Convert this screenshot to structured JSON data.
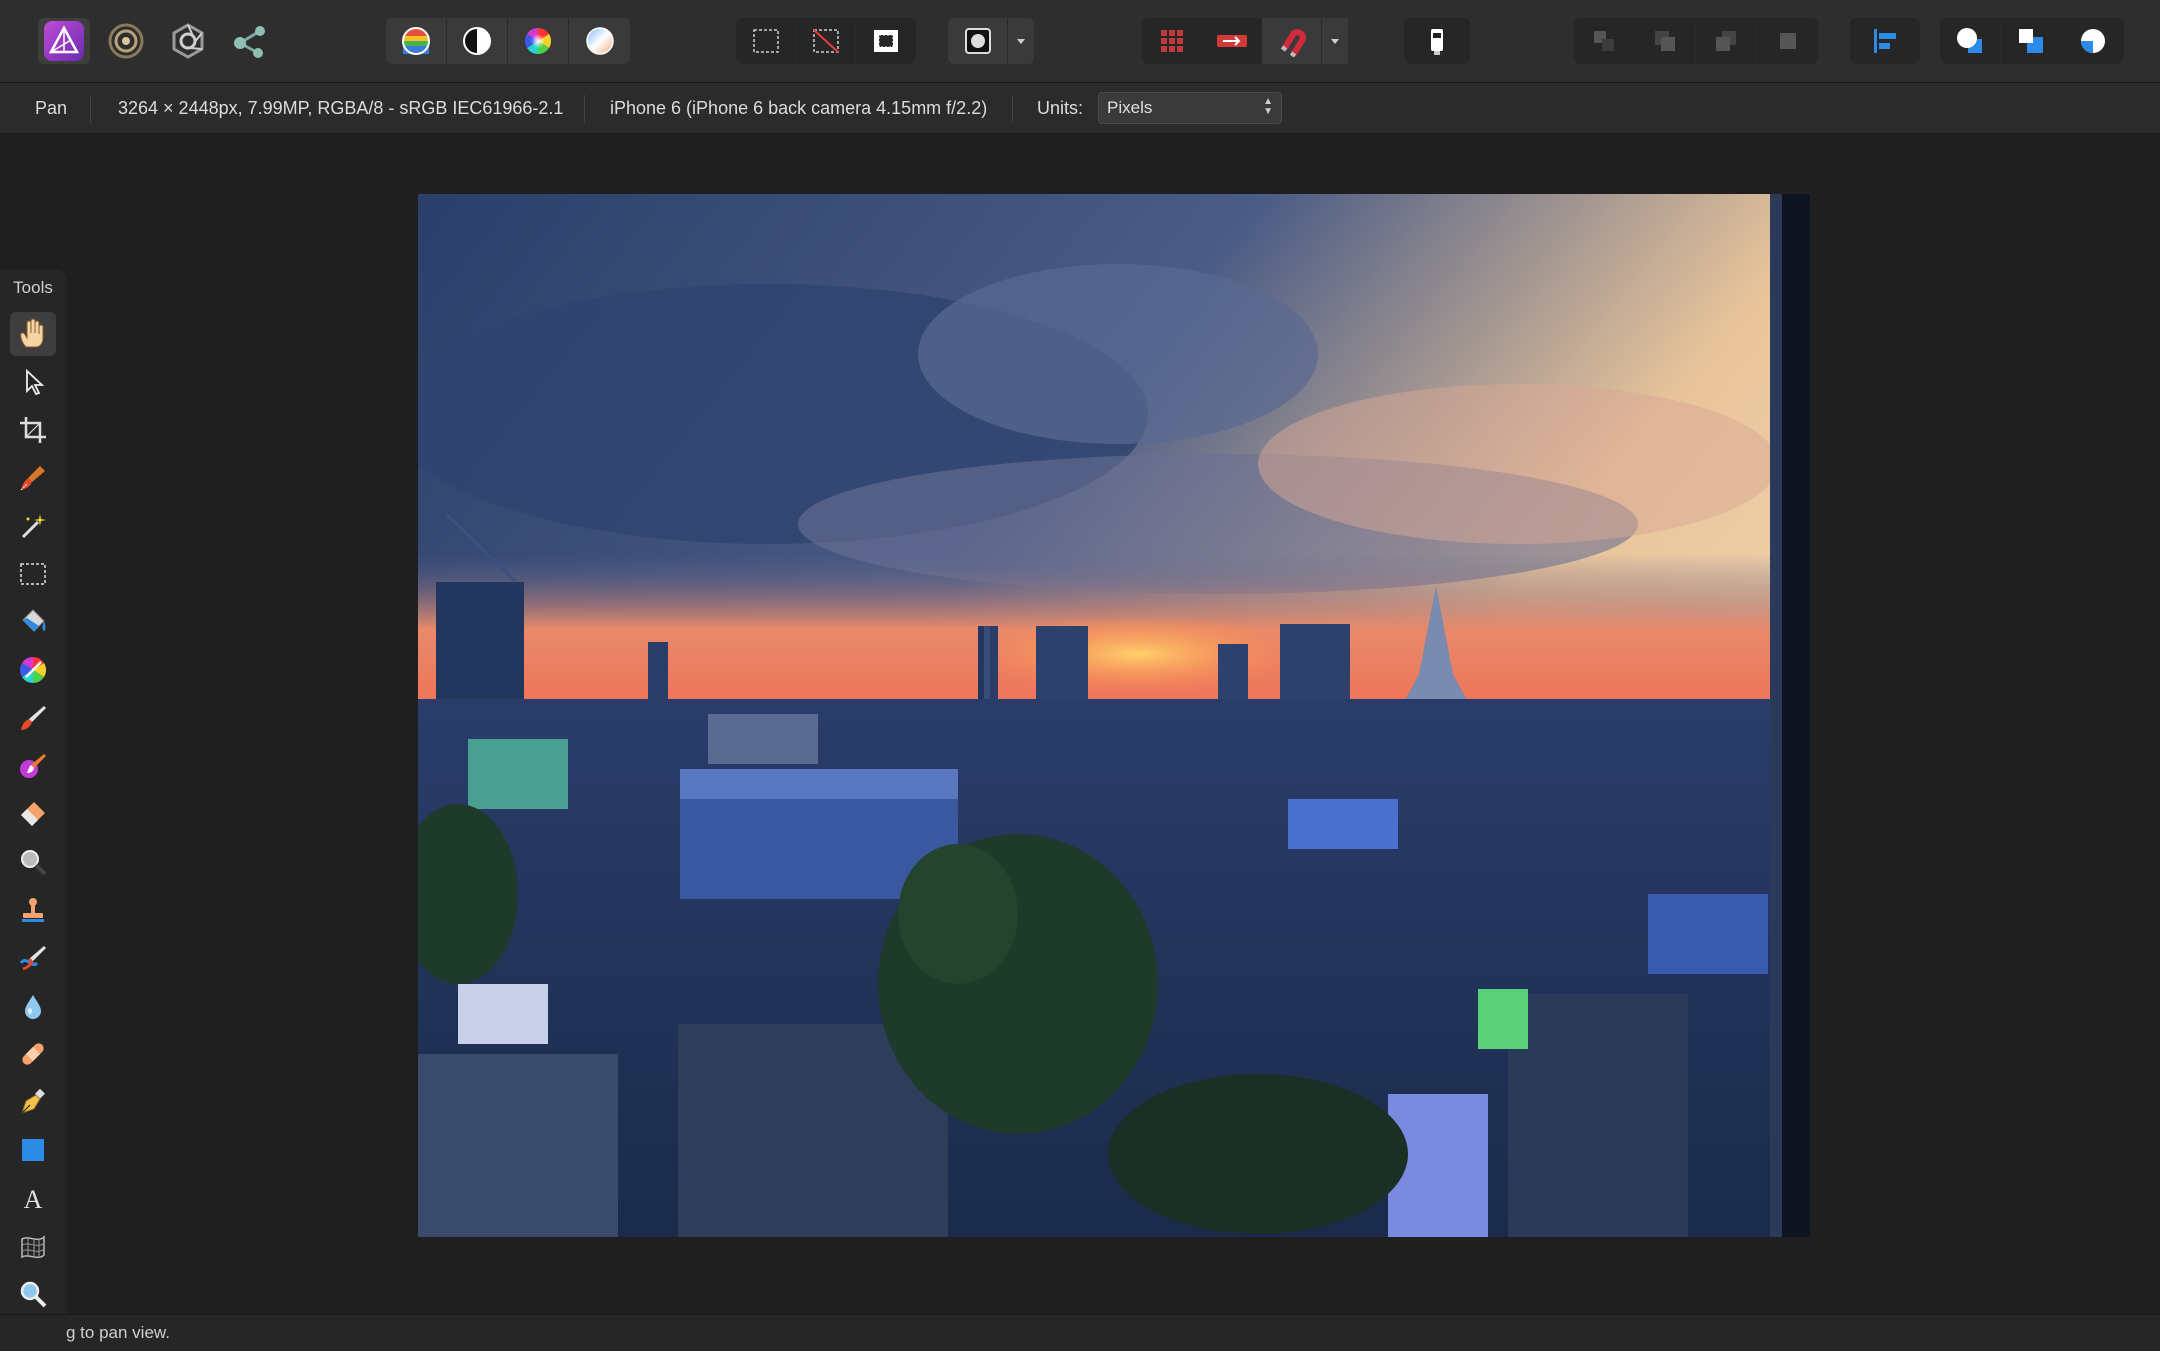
{
  "toolbar": {
    "personas": [
      {
        "name": "photo-persona",
        "icon": "affinity-photo-logo-icon"
      },
      {
        "name": "liquify-persona",
        "icon": "liquify-swirl-icon"
      },
      {
        "name": "develop-persona",
        "icon": "develop-aperture-icon"
      },
      {
        "name": "export-persona",
        "icon": "share-nodes-icon"
      }
    ],
    "color_tools": [
      "auto-levels-icon",
      "auto-contrast-icon",
      "auto-colors-icon",
      "auto-white-balance-icon"
    ],
    "selection_tools": [
      "select-all-icon",
      "deselect-icon",
      "invert-selection-icon"
    ],
    "quick_mask_icon": "quick-mask-icon",
    "snapping_tools": [
      "grid-icon",
      "assistant-icon",
      "snapping-magnet-icon"
    ],
    "brush_icon": "brush-preview-icon",
    "arrange_tools": [
      "move-to-back-icon",
      "move-back-icon",
      "move-forward-icon",
      "move-to-front-icon"
    ],
    "align_icon": "align-left-icon",
    "boolean_tools": [
      "add-icon",
      "subtract-icon",
      "intersect-icon"
    ]
  },
  "context": {
    "tool_name": "Pan",
    "image_info": "3264 × 2448px, 7.99MP, RGBA/8 - sRGB IEC61966-2.1",
    "camera_info": "iPhone 6 (iPhone 6 back camera 4.15mm f/2.2)",
    "units_label": "Units:",
    "units_value": "Pixels"
  },
  "tools_panel": {
    "title": "Tools",
    "items": [
      {
        "name": "pan-tool",
        "icon": "hand-icon",
        "active": true
      },
      {
        "name": "move-tool",
        "icon": "arrow-pointer-icon"
      },
      {
        "name": "crop-tool",
        "icon": "crop-icon"
      },
      {
        "name": "selection-brush-tool",
        "icon": "selection-brush-icon"
      },
      {
        "name": "flood-select-tool",
        "icon": "magic-wand-icon"
      },
      {
        "name": "marquee-tool",
        "icon": "rectangle-marquee-icon"
      },
      {
        "name": "flood-fill-tool",
        "icon": "paint-bucket-icon"
      },
      {
        "name": "gradient-tool",
        "icon": "color-wheel-icon"
      },
      {
        "name": "paint-brush-tool",
        "icon": "paint-brush-icon"
      },
      {
        "name": "color-replacement-tool",
        "icon": "color-replace-brush-icon"
      },
      {
        "name": "erase-brush-tool",
        "icon": "eraser-icon"
      },
      {
        "name": "dodge-brush-tool",
        "icon": "dodge-icon"
      },
      {
        "name": "clone-brush-tool",
        "icon": "clone-stamp-icon"
      },
      {
        "name": "smudge-brush-tool",
        "icon": "smudge-icon"
      },
      {
        "name": "blur-brush-tool",
        "icon": "water-drop-icon"
      },
      {
        "name": "healing-brush-tool",
        "icon": "bandage-icon"
      },
      {
        "name": "pen-tool",
        "icon": "pen-nib-icon"
      },
      {
        "name": "rectangle-tool",
        "icon": "rectangle-shape-icon"
      },
      {
        "name": "text-tool",
        "icon": "text-icon"
      },
      {
        "name": "mesh-warp-tool",
        "icon": "mesh-warp-icon"
      },
      {
        "name": "zoom-tool",
        "icon": "magnifier-icon"
      }
    ]
  },
  "status": {
    "hint": "g to pan view."
  },
  "colors": {
    "toolbar_bg": "#2e2e2e",
    "context_bg": "#2b2b2b",
    "canvas_bg": "#1f1f1f",
    "panel_bg": "#262626",
    "accent_blue": "#2b8be6"
  }
}
